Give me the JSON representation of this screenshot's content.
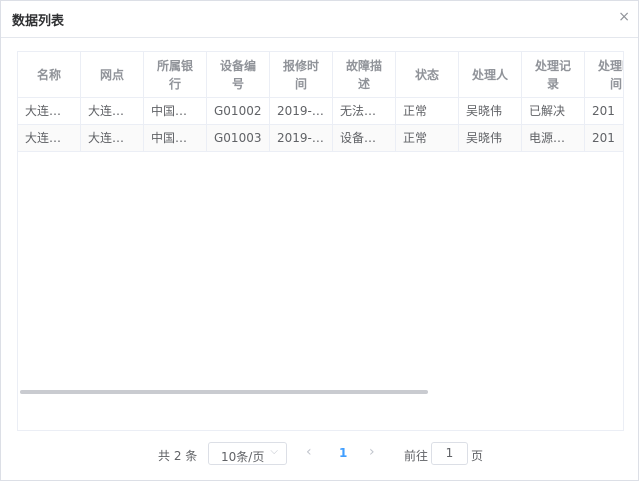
{
  "dialog": {
    "title": "数据列表",
    "close_glyph": "×"
  },
  "table": {
    "columns": [
      "名称",
      "网点",
      "所属银行",
      "设备编号",
      "报修时间",
      "故障描述",
      "状态",
      "处理人",
      "处理记录",
      "处理时间"
    ],
    "rows": [
      [
        "大连…",
        "大连…",
        "中国…",
        "G01002",
        "2019-…",
        "无法…",
        "正常",
        "吴晓伟",
        "已解决",
        "201"
      ],
      [
        "大连…",
        "大连…",
        "中国…",
        "G01003",
        "2019-…",
        "设备…",
        "正常",
        "吴晓伟",
        "电源…",
        "201"
      ]
    ]
  },
  "pagination": {
    "total_text": "共 2 条",
    "page_size": "10条/页",
    "prev_glyph": "‹",
    "current_page": "1",
    "next_glyph": "›",
    "goto_label": "前往",
    "goto_value": "1",
    "goto_suffix": "页"
  }
}
